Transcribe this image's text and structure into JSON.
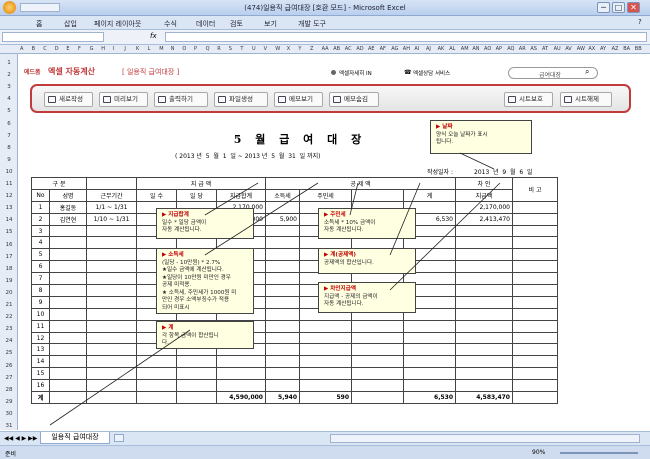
{
  "window": {
    "title": "(474)일용직 급여대장 [호환 모드] - Microsoft Excel",
    "min": "─",
    "max": "□",
    "close": "✕"
  },
  "menu": [
    "홈",
    "삽입",
    "페이지 레이아웃",
    "수식",
    "데이터",
    "검토",
    "보기",
    "개발 도구"
  ],
  "formula": {
    "namebox_value": "",
    "fx": "fx",
    "value": ""
  },
  "columns": [
    "A",
    "B",
    "C",
    "D",
    "E",
    "F",
    "G",
    "H",
    "I",
    "J",
    "K",
    "L",
    "M",
    "N",
    "O",
    "P",
    "Q",
    "R",
    "S",
    "T",
    "U",
    "V",
    "W",
    "X",
    "Y",
    "Z",
    "AA",
    "AB",
    "AC",
    "AD",
    "AE",
    "AF",
    "AG",
    "AH",
    "AI",
    "AJ",
    "AK",
    "AL",
    "AM",
    "AN",
    "AO",
    "AP",
    "AQ",
    "AR",
    "AS",
    "AT",
    "AU",
    "AV",
    "AW",
    "AX",
    "AY",
    "AZ",
    "BA",
    "BB"
  ],
  "header": {
    "logo": "에드폼",
    "app_name": "엑셀 자동계산",
    "subtitle": "[ 일용직 급여대장 ]",
    "links": [
      "엑셀자세히 IN",
      "엑셀상담 서비스"
    ],
    "search_placeholder": "급여대장",
    "toolbar": [
      "새로작성",
      "미리보기",
      "출력하기",
      "파일생성",
      "메모보기",
      "메모숨김"
    ],
    "protect": [
      "시트보호",
      "시트해제"
    ]
  },
  "sheet": {
    "title": "5  월  급 여 대 장",
    "period": "( 2013 년  5  월  1  일 ~ 2013 년  5  월  31  일 까지)",
    "date_label": "작성일자 :",
    "date_value": "2013  년  9  월  6  일",
    "group_headers": {
      "basic": "구 분",
      "pay": "지 급 액",
      "deduct": "공 제 액",
      "net": "차 인",
      "remark": "비 고"
    },
    "col_headers": [
      "No",
      "성명",
      "근무기간",
      "일 수",
      "일 당",
      "지급합계",
      "소득세",
      "주민세",
      "",
      "계",
      "지급액"
    ],
    "rows": [
      {
        "no": "1",
        "name": "홍길동",
        "period": "1/1 ~ 1/31",
        "days": "",
        "daily": "",
        "total": "2,170,000",
        "income_tax": "",
        "resident_tax": "",
        "sum": "",
        "net": "2,170,000"
      },
      {
        "no": "2",
        "name": "김연현",
        "period": "1/10 ~ 1/31",
        "days": "",
        "daily": "",
        "total": "2,423,000",
        "income_tax": "5,900",
        "resident_tax": "",
        "sum": "6,530",
        "net": "2,413,470"
      },
      {
        "no": "3"
      },
      {
        "no": "4"
      },
      {
        "no": "5"
      },
      {
        "no": "6"
      },
      {
        "no": "7"
      },
      {
        "no": "8"
      },
      {
        "no": "9"
      },
      {
        "no": "10"
      },
      {
        "no": "11"
      },
      {
        "no": "12"
      },
      {
        "no": "13"
      },
      {
        "no": "14"
      },
      {
        "no": "15"
      },
      {
        "no": "16"
      }
    ],
    "totals": {
      "label": "계",
      "total": "4,590,000",
      "income_tax": "5,940",
      "resident_tax": "590",
      "sum": "6,530",
      "net": "4,583,470"
    }
  },
  "notes": {
    "date": {
      "title": "날짜",
      "body": "양식 오늘 날짜가 표시\n됩니다."
    },
    "pay": {
      "title": "지급합계",
      "body": "일수 * 일당 금액이\n자동 계산됩니다."
    },
    "income": {
      "title": "소득세",
      "body": "(일당 - 10만원) * 2.7%\n★일수 금액에 계산됩니다.\n★일당이 10만원 미만인 경우\n공제 미적용.\n★ 소득세, 주민세가 1000원 미\n만인 경우 소액부징수가 적용\n되어 미표시"
    },
    "resident": {
      "title": "주민세",
      "body": "소득세 * 10% 금액이\n자동 계산됩니다."
    },
    "deduct_sum": {
      "title": "계(공제액)",
      "body": "공제액의 합산입니다."
    },
    "net": {
      "title": "차인지급액",
      "body": "지급액 - 공제의 금액이\n자동 계산됩니다."
    },
    "total": {
      "title": "계",
      "body": "각 항목 금액이 합산됩니\n다."
    }
  },
  "sheet_tabs": [
    "일용직 급여대장"
  ],
  "status": {
    "ready": "준비",
    "zoom": "90%"
  },
  "colors": {
    "accent": "#c23b3b",
    "ribbon": "#dbe6f5",
    "note": "#ffffe1"
  }
}
